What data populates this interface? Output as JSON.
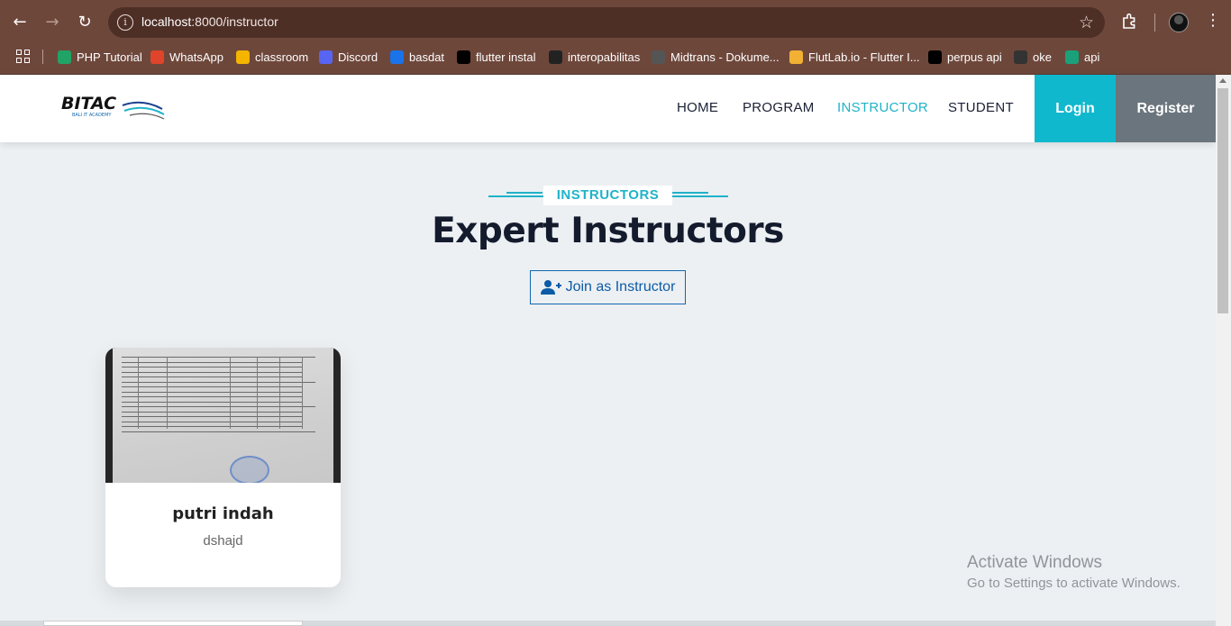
{
  "browser": {
    "url_host": "localhost",
    "url_path": ":8000/instructor",
    "bookmarks": [
      {
        "label": "PHP Tutorial",
        "color": "#21a366"
      },
      {
        "label": "WhatsApp",
        "color": "#e0452b"
      },
      {
        "label": "classroom",
        "color": "#f4b400"
      },
      {
        "label": "Discord",
        "color": "#5865f2"
      },
      {
        "label": "basdat",
        "color": "#1a73e8"
      },
      {
        "label": "flutter instal",
        "color": "#000000"
      },
      {
        "label": "interopabilitas",
        "color": "#222222"
      },
      {
        "label": "Midtrans - Dokume...",
        "color": "#555555"
      },
      {
        "label": "FlutLab.io - Flutter I...",
        "color": "#f2b134"
      },
      {
        "label": "perpus api",
        "color": "#000000"
      },
      {
        "label": "oke",
        "color": "#333333"
      },
      {
        "label": "api",
        "color": "#1aa17a"
      }
    ]
  },
  "header": {
    "logo_text": "BITAC",
    "logo_sub": "BALI IT ACADEMY",
    "nav": [
      "HOME",
      "PROGRAM",
      "INSTRUCTOR",
      "STUDENT"
    ],
    "active_nav": "INSTRUCTOR",
    "login": "Login",
    "register": "Register"
  },
  "section": {
    "subtitle": "INSTRUCTORS",
    "title": "Expert Instructors",
    "join_button": "Join as Instructor"
  },
  "instructors": [
    {
      "name": "putri indah",
      "description": "dshajd"
    }
  ],
  "watermark": {
    "title": "Activate Windows",
    "subtitle": "Go to Settings to activate Windows."
  },
  "colors": {
    "accent": "#1fb3c9",
    "login_bg": "#0fb8cd",
    "register_bg": "#6b757d",
    "browser_frame": "#6e473b"
  }
}
